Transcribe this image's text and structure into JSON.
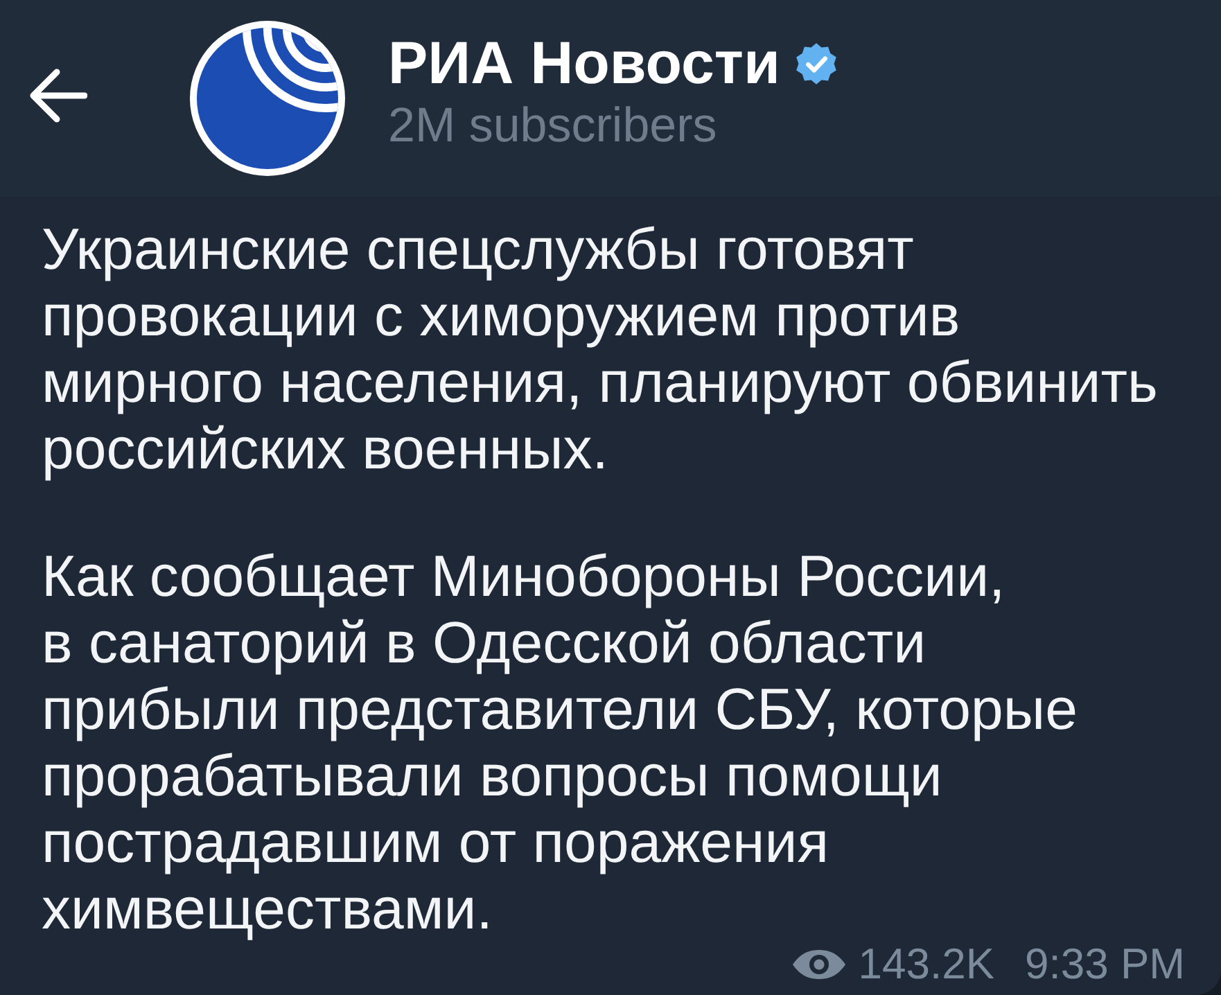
{
  "header": {
    "channel": {
      "name": "РИА Новости",
      "verified": true,
      "subscribers": "2M subscribers"
    }
  },
  "message": {
    "paragraphs": [
      "Украинские спецслужбы готовят\nпровокации с химоружием против\nмирного населения, планируют обвинить\nроссийских военных.",
      "Как сообщает Минобороны России,\nв санаторий в Одесской области\nприбыли представители СБУ, которые\nпрорабатывали вопросы помощи\nпострадавшим от поражения\nхимвеществами."
    ],
    "views": "143.2K",
    "time": "9:33 PM"
  }
}
